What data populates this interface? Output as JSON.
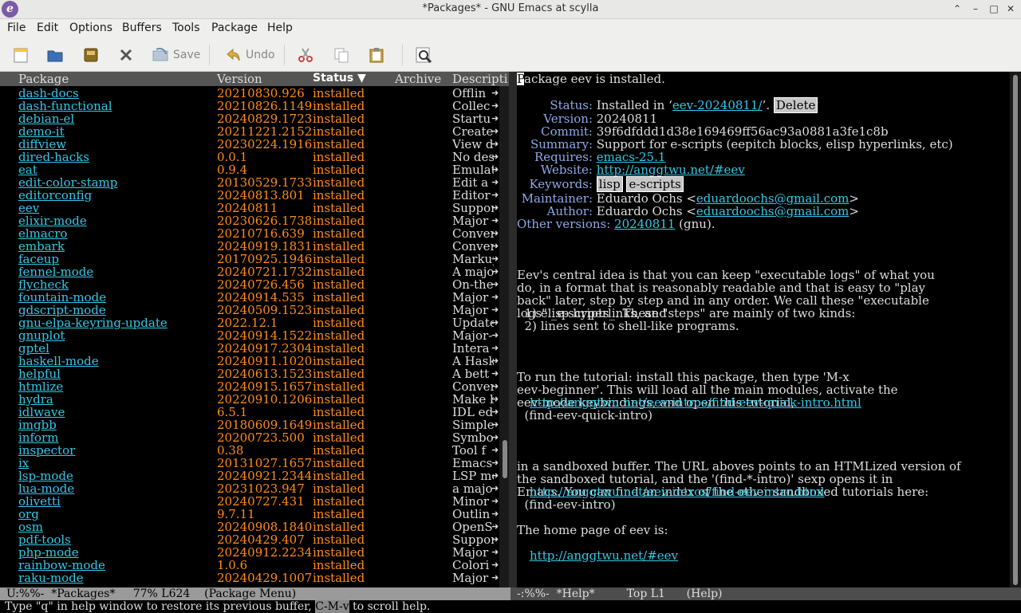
{
  "window": {
    "title": "*Packages* - GNU Emacs at scylla"
  },
  "menu": [
    "File",
    "Edit",
    "Options",
    "Buffers",
    "Tools",
    "Package",
    "Help"
  ],
  "toolbar": {
    "save_label": "Save",
    "undo_label": "Undo"
  },
  "table": {
    "headers": {
      "package": "Package",
      "version": "Version",
      "status": "Status ▼",
      "archive": "Archive",
      "description": "Descripti"
    },
    "rows": [
      {
        "name": "dash-docs",
        "version": "20210830.926",
        "status": "installed",
        "desc": "Offlin"
      },
      {
        "name": "dash-functional",
        "version": "20210826.1149",
        "status": "installed",
        "desc": "Collec"
      },
      {
        "name": "debian-el",
        "version": "20240829.1723",
        "status": "installed",
        "desc": "Startu"
      },
      {
        "name": "demo-it",
        "version": "20211221.2152",
        "status": "installed",
        "desc": "Create"
      },
      {
        "name": "diffview",
        "version": "20230224.1916",
        "status": "installed",
        "desc": "View d"
      },
      {
        "name": "dired-hacks",
        "version": "0.0.1",
        "status": "installed",
        "desc": "No des"
      },
      {
        "name": "eat",
        "version": "0.9.4",
        "status": "installed",
        "desc": "Emulat"
      },
      {
        "name": "edit-color-stamp",
        "version": "20130529.1733",
        "status": "installed",
        "desc": "Edit a"
      },
      {
        "name": "editorconfig",
        "version": "20240813.801",
        "status": "installed",
        "desc": "Editor"
      },
      {
        "name": "eev",
        "version": "20240811",
        "status": "installed",
        "desc": "Suppor"
      },
      {
        "name": "elixir-mode",
        "version": "20230626.1738",
        "status": "installed",
        "desc": "Major "
      },
      {
        "name": "elmacro",
        "version": "20210716.639",
        "status": "installed",
        "desc": "Conver"
      },
      {
        "name": "embark",
        "version": "20240919.1831",
        "status": "installed",
        "desc": "Conven"
      },
      {
        "name": "faceup",
        "version": "20170925.1946",
        "status": "installed",
        "desc": "Markup"
      },
      {
        "name": "fennel-mode",
        "version": "20240721.1732",
        "status": "installed",
        "desc": "A majo"
      },
      {
        "name": "flycheck",
        "version": "20240726.456",
        "status": "installed",
        "desc": "On-the"
      },
      {
        "name": "fountain-mode",
        "version": "20240914.535",
        "status": "installed",
        "desc": "Major "
      },
      {
        "name": "gdscript-mode",
        "version": "20240509.1523",
        "status": "installed",
        "desc": "Major "
      },
      {
        "name": "gnu-elpa-keyring-update",
        "version": "2022.12.1",
        "status": "installed",
        "desc": "Update"
      },
      {
        "name": "gnuplot",
        "version": "20240914.1522",
        "status": "installed",
        "desc": "Major-"
      },
      {
        "name": "gptel",
        "version": "20240917.2304",
        "status": "installed",
        "desc": "Intera"
      },
      {
        "name": "haskell-mode",
        "version": "20240911.1020",
        "status": "installed",
        "desc": "A Hask"
      },
      {
        "name": "helpful",
        "version": "20240613.1523",
        "status": "installed",
        "desc": "A bett"
      },
      {
        "name": "htmlize",
        "version": "20240915.1657",
        "status": "installed",
        "desc": "Conver"
      },
      {
        "name": "hydra",
        "version": "20220910.1206",
        "status": "installed",
        "desc": "Make b"
      },
      {
        "name": "idlwave",
        "version": "6.5.1",
        "status": "installed",
        "desc": "IDL ed"
      },
      {
        "name": "imgbb",
        "version": "20180609.1649",
        "status": "installed",
        "desc": "Simple"
      },
      {
        "name": "inform",
        "version": "20200723.500",
        "status": "installed",
        "desc": "Symbol"
      },
      {
        "name": "inspector",
        "version": "0.38",
        "status": "installed",
        "desc": "Tool f"
      },
      {
        "name": "ix",
        "version": "20131027.1657",
        "status": "installed",
        "desc": "Emacs "
      },
      {
        "name": "lsp-mode",
        "version": "20240921.2344",
        "status": "installed",
        "desc": "LSP mo"
      },
      {
        "name": "lua-mode",
        "version": "20231023.947",
        "status": "installed",
        "desc": "a majo"
      },
      {
        "name": "olivetti",
        "version": "20240727.431",
        "status": "installed",
        "desc": "Minor "
      },
      {
        "name": "org",
        "version": "9.7.11",
        "status": "installed",
        "desc": "Outlin"
      },
      {
        "name": "osm",
        "version": "20240908.1840",
        "status": "installed",
        "desc": "OpenSt"
      },
      {
        "name": "pdf-tools",
        "version": "20240429.407",
        "status": "installed",
        "desc": "Suppor"
      },
      {
        "name": "php-mode",
        "version": "20240912.2234",
        "status": "installed",
        "desc": "Major "
      },
      {
        "name": "rainbow-mode",
        "version": "1.0.6",
        "status": "installed",
        "desc": "Colori"
      },
      {
        "name": "raku-mode",
        "version": "20240429.1007",
        "status": "installed",
        "desc": "Major "
      }
    ]
  },
  "help": {
    "line1": "ackage eev is installed.",
    "cursor_char": "P",
    "status_key": "Status:",
    "status_pre": " Installed in ‘",
    "status_link": "eev-20240811/",
    "status_post": "’.",
    "delete_label": "Delete",
    "version_key": "Version:",
    "version_val": " 20240811",
    "commit_key": "Commit:",
    "commit_val": " 39f6dfddd1d38e169469ff56ac93a0881a3fe1c8b",
    "summary_key": "Summary:",
    "summary_val": " Support for e-scripts (eepitch blocks, elisp hyperlinks, etc)",
    "requires_key": "Requires:",
    "requires_link": "emacs-25.1",
    "website_key": "Website:",
    "website_link": "http://anggtwu.net/#eev",
    "keywords_key": "Keywords:",
    "kw1": "lisp",
    "kw2": "e-scripts",
    "maintainer_key": "Maintainer:",
    "maintainer_pre": " Eduardo Ochs <",
    "maintainer_link": "eduardoochs@gmail.com",
    "maintainer_post": ">",
    "author_key": "Author:",
    "author_pre": " Eduardo Ochs <",
    "author_link": "eduardoochs@gmail.com",
    "author_post": ">",
    "other_key": "Other versions:",
    "other_link": "20240811",
    "other_post": " (gnu).",
    "para1": [
      "Eev's central idea is that you can keep \"executable logs\" of what you",
      "do, in a format that is reasonably readable and that is easy to \"play",
      "back\" later, step by step and in any order. We call these \"executable",
      "logs\" _e-scripts_. These \"steps\" are mainly of two kinds:"
    ],
    "list1": "  1) elisp hyperlinks, and",
    "list2": "  2) lines sent to shell-like programs.",
    "para2": [
      "To run the tutorial: install this package, then type 'M-x",
      "eev-beginner'. This will load all the main modules, activate the",
      "eev-mode keybindings, and open this tutorial,"
    ],
    "link_quick": "http://anggtwu.net/eev-intros/find-eev-quick-intro.html",
    "sexp_quick": "  (find-eev-quick-intro)",
    "para3": [
      "in a sandboxed buffer. The URL aboves points to an HTMLized version of",
      "the sandboxed tutorial, and the '(find-*-intro)' sexp opens it in",
      "Emacs. You can find an index of the other sandboxed tutorials here:"
    ],
    "link_intro": "http://anggtwu.net/eev-intros/find-eev-intro.html",
    "sexp_intro": "  (find-eev-intro)",
    "para4": "The home page of eev is:",
    "link_home": "http://anggtwu.net/#eev"
  },
  "modeline_left": "U:%%-  *Packages*     77% L624    (Package Menu)",
  "modeline_right": "-:%%-  *Help*         Top L1      (Help)",
  "echo": {
    "pre": "Type \"q\" in help window to restore its previous buffer, ",
    "key": "C-M-v",
    "post": " to scroll help."
  }
}
